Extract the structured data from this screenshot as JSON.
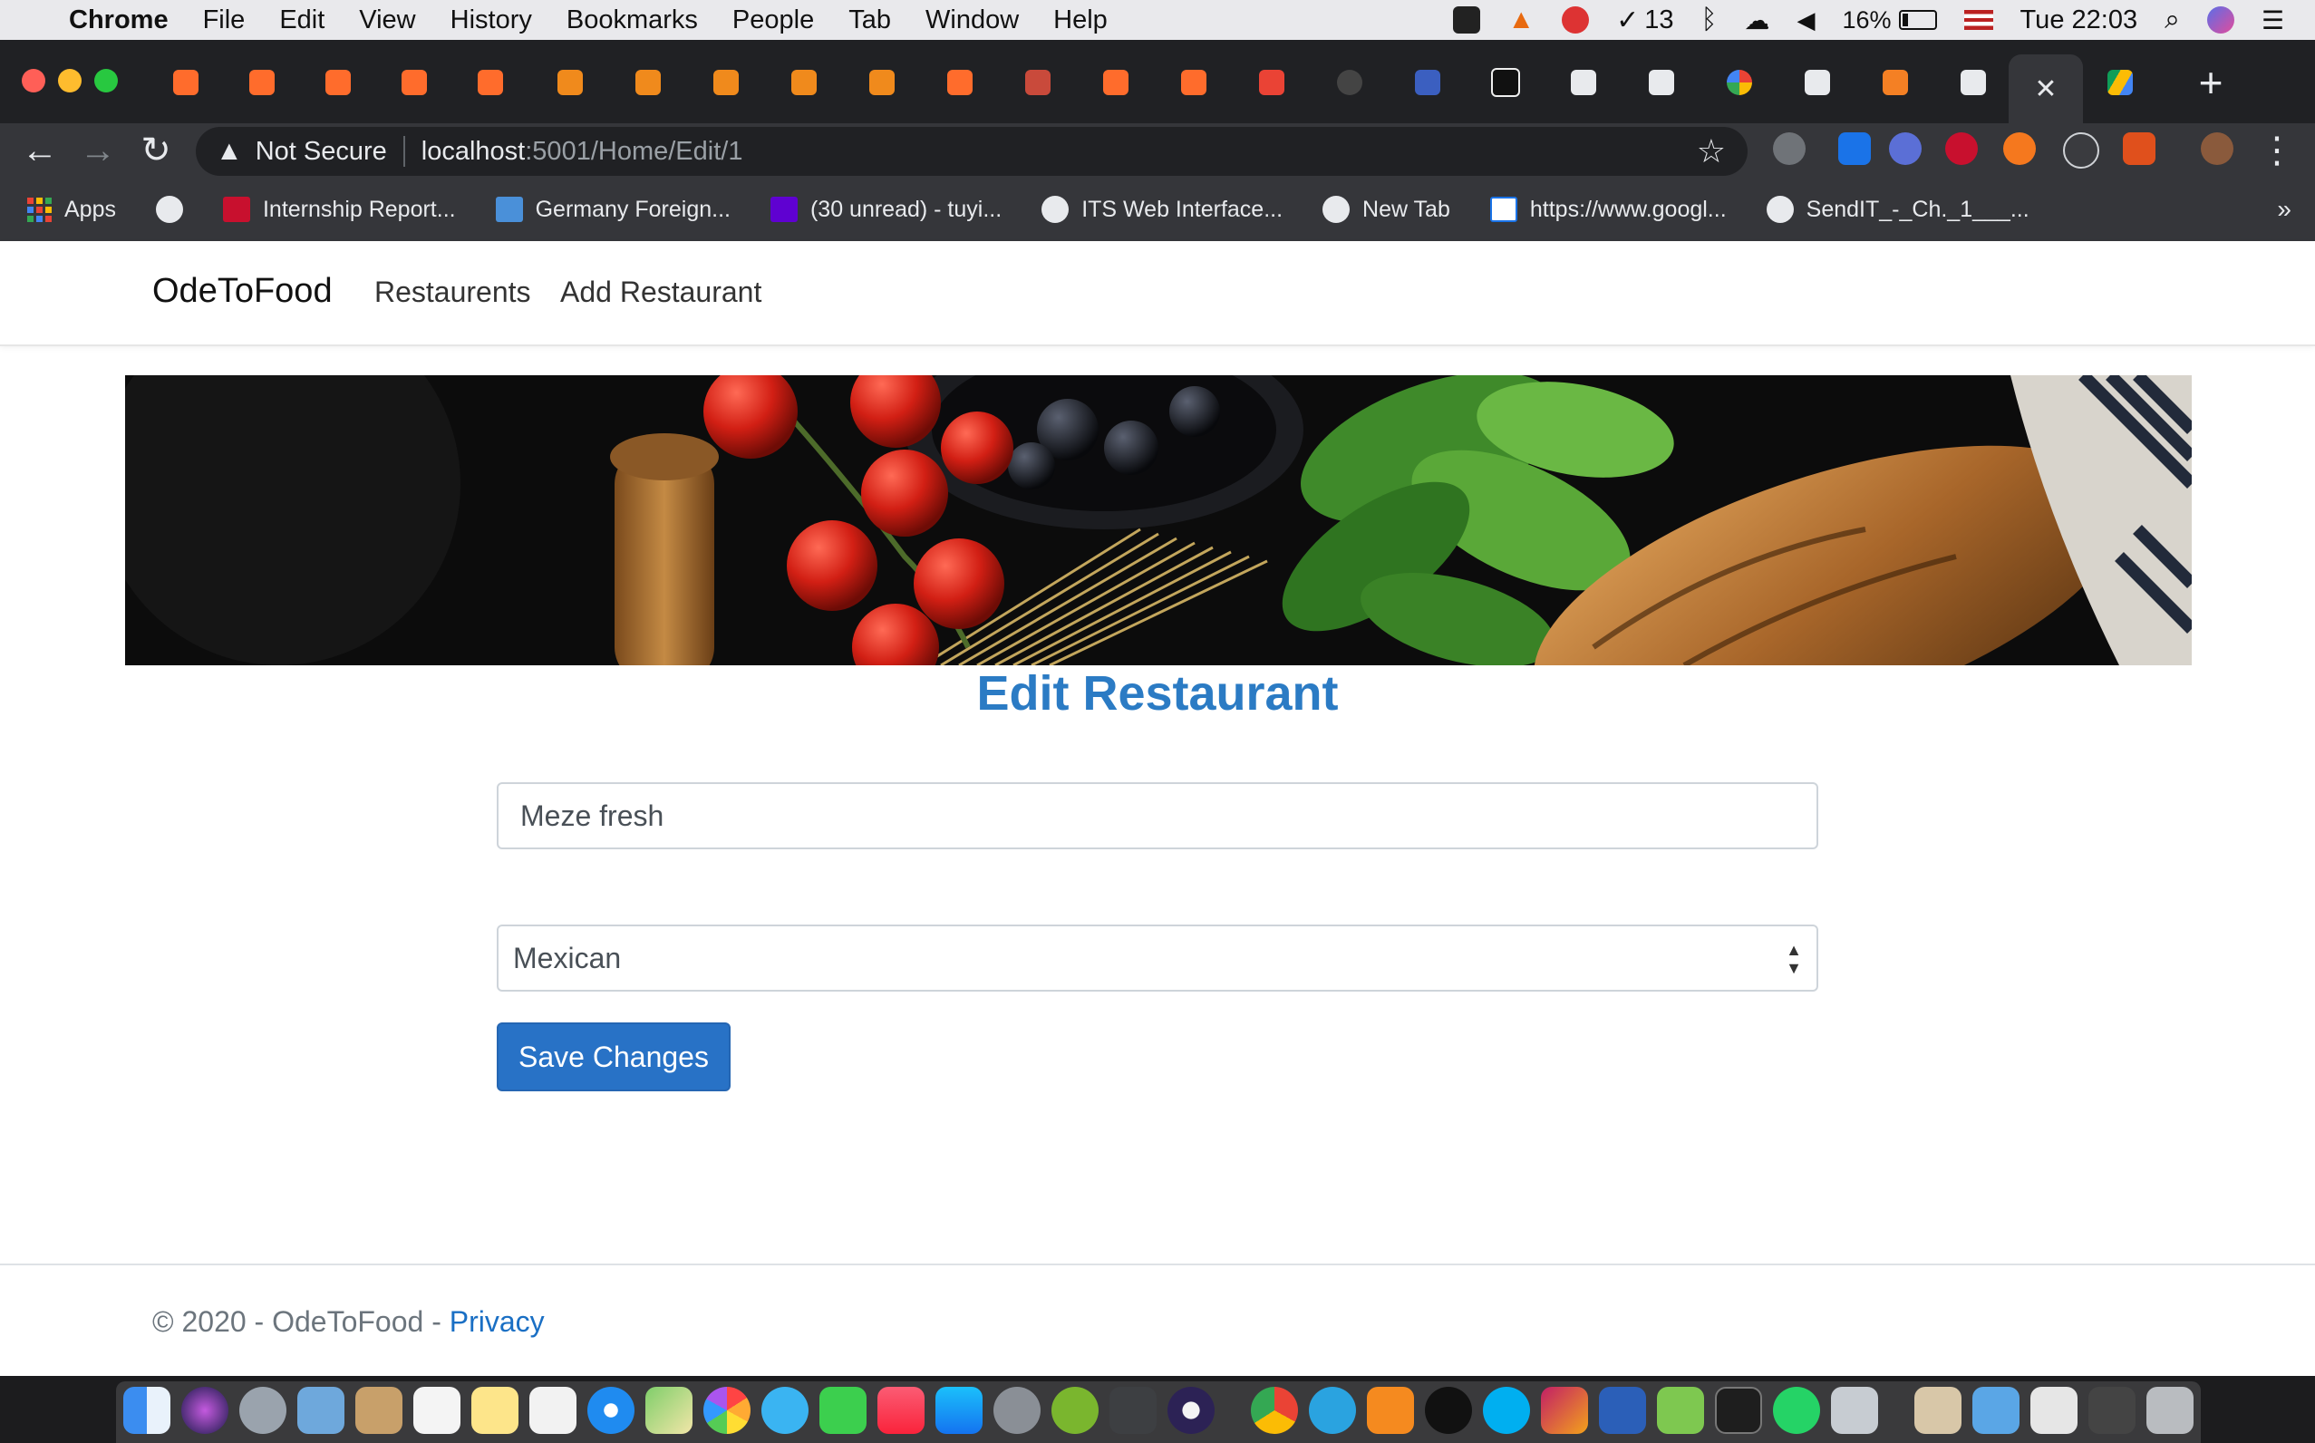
{
  "menubar": {
    "app": "Chrome",
    "items": [
      "File",
      "Edit",
      "View",
      "History",
      "Bookmarks",
      "People",
      "Tab",
      "Window",
      "Help"
    ],
    "notification_count": "13",
    "battery": "16%",
    "clock": "Tue 22:03"
  },
  "browser": {
    "security_label": "Not Secure",
    "url_host": "localhost",
    "url_path": ":5001/Home/Edit/1"
  },
  "bookmarks": [
    "Apps",
    "Internship Report...",
    "Germany Foreign...",
    "(30 unread) - tuyi...",
    "ITS Web Interface...",
    "New Tab",
    "https://www.googl...",
    "SendIT_-_Ch._1___..."
  ],
  "site": {
    "brand": "OdeToFood",
    "nav": [
      "Restaurents",
      "Add Restaurant"
    ],
    "page_title": "Edit Restaurant",
    "form": {
      "name_value": "Meze fresh",
      "cuisine_selected": "Mexican",
      "save_label": "Save Changes"
    },
    "footer": {
      "copyright": "© 2020 - OdeToFood - ",
      "privacy_link": "Privacy"
    }
  },
  "colors": {
    "heading": "#2b7bc4",
    "primary_button": "#2872c6",
    "link": "#1a6fc4"
  }
}
